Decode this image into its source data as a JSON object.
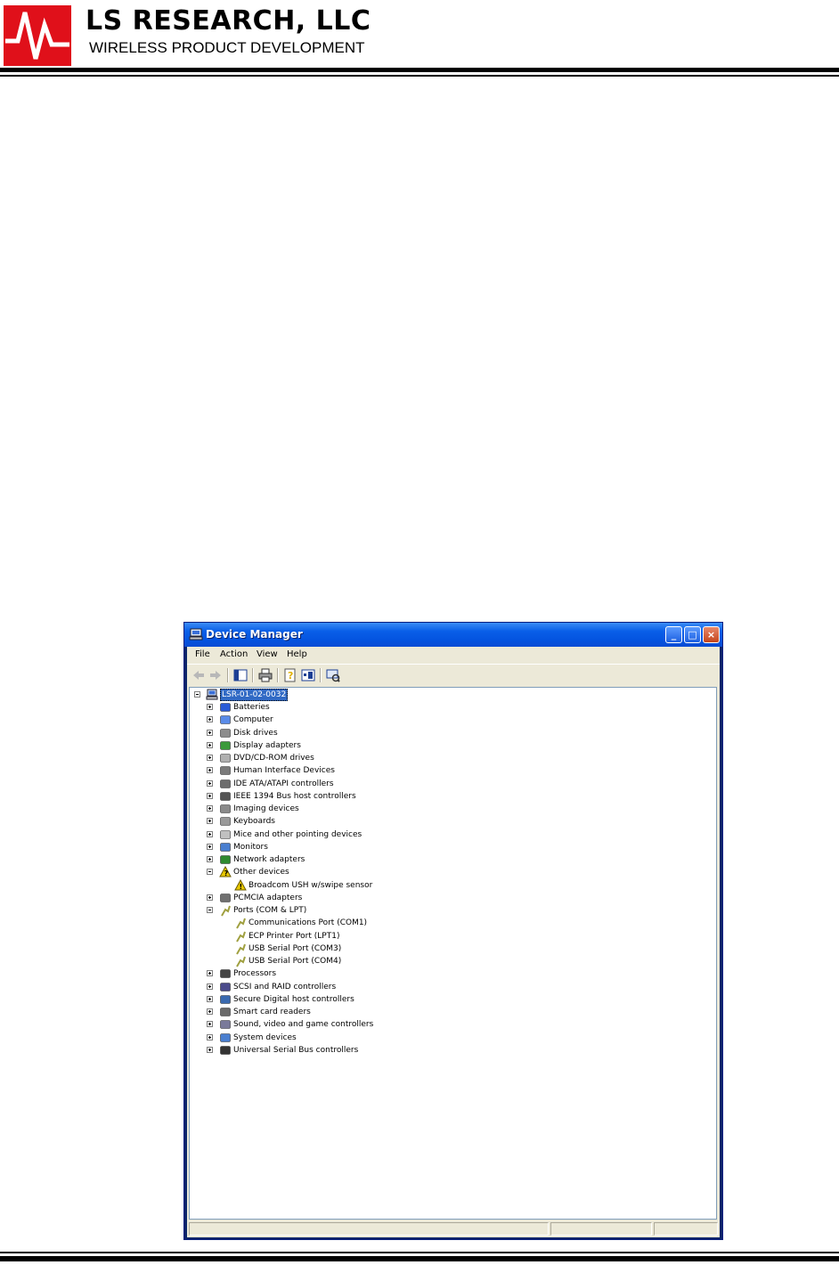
{
  "document": {
    "company": "LS RESEARCH, LLC",
    "tagline": "WIRELESS PRODUCT DEVELOPMENT"
  },
  "window": {
    "title": "Device Manager",
    "controls": {
      "minimize": "_",
      "maximize": "□",
      "close": "×"
    }
  },
  "menu": [
    "File",
    "Action",
    "View",
    "Help"
  ],
  "toolbar": [
    "back-icon",
    "forward-icon",
    "show-hide-tree-icon",
    "print-icon",
    "properties-icon",
    "update-driver-icon",
    "scan-hardware-icon"
  ],
  "tree": {
    "root": "LSR-01-02-0032",
    "items": [
      {
        "label": "Batteries",
        "icon": "battery-icon",
        "expanded": false
      },
      {
        "label": "Computer",
        "icon": "computer-icon",
        "expanded": false
      },
      {
        "label": "Disk drives",
        "icon": "disk-drive-icon",
        "expanded": false
      },
      {
        "label": "Display adapters",
        "icon": "display-adapter-icon",
        "expanded": false
      },
      {
        "label": "DVD/CD-ROM drives",
        "icon": "dvd-drive-icon",
        "expanded": false
      },
      {
        "label": "Human Interface Devices",
        "icon": "hid-icon",
        "expanded": false
      },
      {
        "label": "IDE ATA/ATAPI controllers",
        "icon": "ide-controller-icon",
        "expanded": false
      },
      {
        "label": "IEEE 1394 Bus host controllers",
        "icon": "ieee1394-icon",
        "expanded": false
      },
      {
        "label": "Imaging devices",
        "icon": "imaging-device-icon",
        "expanded": false
      },
      {
        "label": "Keyboards",
        "icon": "keyboard-icon",
        "expanded": false
      },
      {
        "label": "Mice and other pointing devices",
        "icon": "mouse-icon",
        "expanded": false
      },
      {
        "label": "Monitors",
        "icon": "monitor-icon",
        "expanded": false
      },
      {
        "label": "Network adapters",
        "icon": "network-adapter-icon",
        "expanded": false
      },
      {
        "label": "Other devices",
        "icon": "unknown-device-icon",
        "expanded": true,
        "children": [
          {
            "label": "Broadcom USH w/swipe sensor",
            "icon": "warning-device-icon"
          }
        ]
      },
      {
        "label": "PCMCIA adapters",
        "icon": "pcmcia-icon",
        "expanded": false
      },
      {
        "label": "Ports (COM & LPT)",
        "icon": "port-icon",
        "expanded": true,
        "children": [
          {
            "label": "Communications Port (COM1)",
            "icon": "port-icon"
          },
          {
            "label": "ECP Printer Port (LPT1)",
            "icon": "port-icon"
          },
          {
            "label": "USB Serial Port (COM3)",
            "icon": "port-icon"
          },
          {
            "label": "USB Serial Port (COM4)",
            "icon": "port-icon"
          }
        ]
      },
      {
        "label": "Processors",
        "icon": "processor-icon",
        "expanded": false
      },
      {
        "label": "SCSI and RAID controllers",
        "icon": "scsi-icon",
        "expanded": false
      },
      {
        "label": "Secure Digital host controllers",
        "icon": "sd-host-icon",
        "expanded": false
      },
      {
        "label": "Smart card readers",
        "icon": "smart-card-icon",
        "expanded": false
      },
      {
        "label": "Sound, video and game controllers",
        "icon": "sound-icon",
        "expanded": false
      },
      {
        "label": "System devices",
        "icon": "system-device-icon",
        "expanded": false
      },
      {
        "label": "Universal Serial Bus controllers",
        "icon": "usb-icon",
        "expanded": false
      }
    ]
  },
  "colors": {
    "selection": "#316ac5",
    "titlebar": "#0a5fe8",
    "logo_red": "#e0101a"
  }
}
